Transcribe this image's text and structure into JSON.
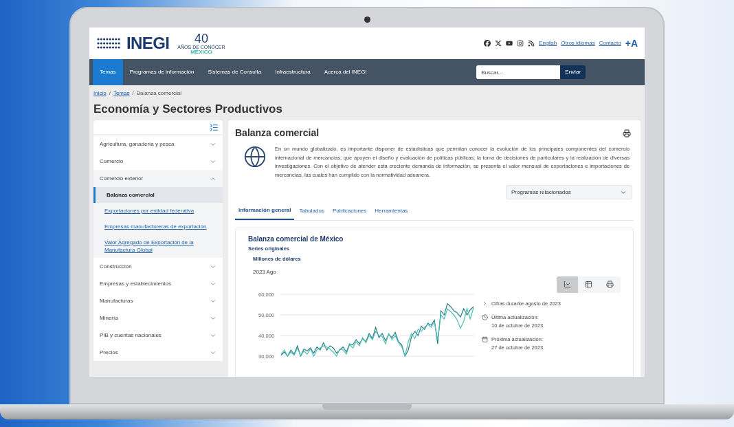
{
  "header": {
    "logo": {
      "name": "INEGI",
      "anniversary": "40",
      "tagline": "AÑOS DE CONOCER",
      "country": "MÉXICO"
    },
    "links": [
      {
        "label": "English"
      },
      {
        "label": "Otros idiomas"
      },
      {
        "label": "Contacto"
      }
    ],
    "font_size_button": "+A"
  },
  "nav": {
    "items": [
      {
        "label": "Temas",
        "selected": true
      },
      {
        "label": "Programas de información",
        "selected": false
      },
      {
        "label": "Sistemas de Consulta",
        "selected": false
      },
      {
        "label": "Infraestructura",
        "selected": false
      },
      {
        "label": "Acerca del INEGI",
        "selected": false
      }
    ],
    "search": {
      "placeholder": "Buscar..."
    },
    "search_button": "Enviar"
  },
  "breadcrumb": {
    "separator": "/",
    "items": [
      {
        "label": "Inicio",
        "link": true
      },
      {
        "label": "Temas",
        "link": true
      },
      {
        "label": "Balanza comercial",
        "link": false
      }
    ]
  },
  "page_title": "Economía y Sectores Productivos",
  "sidebar": {
    "items": [
      {
        "label": "Agricultura, ganadería y pesca",
        "expanded": false
      },
      {
        "label": "Comercio",
        "expanded": false
      },
      {
        "label": "Comercio exterior",
        "expanded": true,
        "children": [
          {
            "label": "Balanza comercial",
            "selected": true
          },
          {
            "label": "Exportaciones por entidad federativa",
            "selected": false
          },
          {
            "label": "Empresas manufactureras de exportación",
            "selected": false
          },
          {
            "label": "Valor Agregado de Exportación de la Manufactura Global",
            "selected": false
          }
        ]
      },
      {
        "label": "Construcción",
        "expanded": false
      },
      {
        "label": "Empresas y establecimientos",
        "expanded": false
      },
      {
        "label": "Manufacturas",
        "expanded": false
      },
      {
        "label": "Minería",
        "expanded": false
      },
      {
        "label": "PIB y cuentas nacionales",
        "expanded": false
      },
      {
        "label": "Precios",
        "expanded": false
      }
    ]
  },
  "main": {
    "title": "Balanza comercial",
    "description": "En un mundo globalizado, es importante disponer de estadísticas que permitan conocer la evolución de los principales componentes del comercio internacional de mercancías, que apoyen el diseño y evaluación de políticas públicas, la toma de decisiones de particulares y la realización de diversas investigaciones. Con el objetivo de atender esta creciente demanda de información, se presenta el valor mensual de exportaciones e importaciones de mercancías, las cuales han cumplido con la normatividad aduanera.",
    "dropdown": "Programas relacionados",
    "tabs": [
      {
        "label": "Información general",
        "selected": true
      },
      {
        "label": "Tabulados",
        "selected": false
      },
      {
        "label": "Publicaciones",
        "selected": false
      },
      {
        "label": "Herramientas",
        "selected": false
      }
    ],
    "card": {
      "title": "Balanza comercial de México",
      "subtitle": "Series originales",
      "units": "Millones de dólares",
      "period": "2023 Ago",
      "view_buttons": [
        {
          "kind": "chart",
          "selected": true
        },
        {
          "kind": "table",
          "selected": false
        },
        {
          "kind": "print",
          "selected": false
        }
      ],
      "chart_data": {
        "type": "line",
        "grid": true,
        "ylim": [
          30000,
          60000
        ],
        "yticks": [
          {
            "value": 60000,
            "label": "60,000"
          },
          {
            "value": 50000,
            "label": "50,000"
          },
          {
            "value": 40000,
            "label": "40,000"
          },
          {
            "value": 30000,
            "label": "30,000"
          }
        ],
        "series": [
          {
            "color": "#2a7f86",
            "values": [
              30500,
              32000,
              30000,
              33000,
              31000,
              35000,
              30000,
              33500,
              32500,
              34000,
              31500,
              34500,
              33000,
              36500,
              33000,
              35000,
              34000,
              31500,
              33000,
              34500,
              32000,
              36000,
              35500,
              38000,
              36000,
              38500,
              37000,
              41000,
              38500,
              44000,
              39000,
              41000,
              37500,
              40500,
              39000,
              41500,
              37000,
              35500,
              30000,
              33000,
              39500,
              42000,
              40000,
              44500,
              43000,
              46000,
              45000,
              47500,
              36000,
              52000,
              50000,
              55500,
              54000,
              52000,
              51000,
              49000,
              53000,
              50000,
              52500,
              54000
            ]
          },
          {
            "color": "#4dbfb4",
            "values": [
              31000,
              33000,
              30000,
              32000,
              30500,
              34000,
              30000,
              32500,
              31000,
              33500,
              30000,
              33000,
              34000,
              35000,
              34500,
              33500,
              32000,
              30000,
              33500,
              33000,
              31000,
              35500,
              34000,
              37000,
              35000,
              39000,
              36500,
              40000,
              38000,
              42000,
              40000,
              39500,
              36000,
              41000,
              38000,
              40000,
              36500,
              34500,
              30000,
              37000,
              41000,
              38500,
              43000,
              42000,
              44000,
              45500,
              44000,
              46500,
              38000,
              50000,
              48000,
              53000,
              51500,
              50000,
              47500,
              43500,
              47000,
              53000,
              48000,
              53500
            ]
          }
        ]
      },
      "info": [
        {
          "kind": "link",
          "lines": [
            "Cifras durante agosto de 2023"
          ]
        },
        {
          "kind": "updated",
          "lines": [
            "Última actualización:",
            "10 de octubre de 2023"
          ]
        },
        {
          "kind": "next",
          "lines": [
            "Próxima actualización:",
            "27 de octubre de 2023"
          ]
        }
      ]
    }
  }
}
